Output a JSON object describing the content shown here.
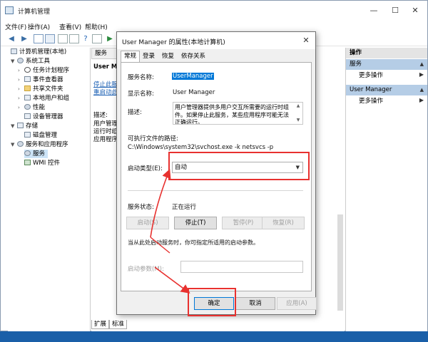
{
  "window": {
    "title": "计算机管理",
    "controls": {
      "minimize": "—",
      "maximize": "☐",
      "close": "✕"
    }
  },
  "menu": [
    "文件(F)",
    "操作(A)",
    "查看(V)",
    "帮助(H)"
  ],
  "tree": {
    "root": "计算机管理(本地)",
    "system_tools": "系统工具",
    "task_scheduler": "任务计划程序",
    "event_viewer": "事件查看器",
    "shared_folders": "共享文件夹",
    "local_users": "本地用户和组",
    "performance": "性能",
    "device_manager": "设备管理器",
    "storage": "存储",
    "disk_management": "磁盘管理",
    "services_apps": "服务和应用程序",
    "services": "服务",
    "wmi": "WMI 控件"
  },
  "center": {
    "tab_fragment": "服务",
    "heading": "User Manag",
    "link_stop": "停止此服务",
    "link_restart": "重启动此服务",
    "desc_label": "描述:",
    "desc_lines": [
      "用户管理器",
      "运行时组件",
      "应用程序所"
    ],
    "bottom_tabs": [
      "扩展",
      "标准"
    ]
  },
  "actions": {
    "header": "操作",
    "section1": "服务",
    "more1": "更多操作",
    "section2": "User Manager",
    "more2": "更多操作"
  },
  "dialog": {
    "title": "User Manager 的属性(本地计算机)",
    "tabs": [
      "常规",
      "登录",
      "恢复",
      "依存关系"
    ],
    "service_name_label": "服务名称:",
    "service_name": "UserManager",
    "display_name_label": "显示名称:",
    "display_name": "User Manager",
    "description_label": "描述:",
    "description": "用户管理器提供多用户交互所需要的运行时组件。如果停止此服务，某些应用程序可能无法正确运行。",
    "exe_label": "可执行文件的路径:",
    "exe_path": "C:\\Windows\\system32\\svchost.exe -k netsvcs -p",
    "startup_label": "启动类型(E):",
    "startup_value": "自动",
    "status_label": "服务状态:",
    "status_value": "正在运行",
    "btn_start": "启动(S)",
    "btn_stop": "停止(T)",
    "btn_pause": "暂停(P)",
    "btn_resume": "恢复(R)",
    "hint": "当从此处启动服务时，你可指定所适用的启动参数。",
    "param_label": "启动参数(M):",
    "param_value": "",
    "btn_ok": "确定",
    "btn_cancel": "取消",
    "btn_apply": "应用(A)"
  },
  "colors": {
    "accent": "#0078d7",
    "annotation_red": "#e8312f",
    "action_selected": "#b5cde6"
  }
}
